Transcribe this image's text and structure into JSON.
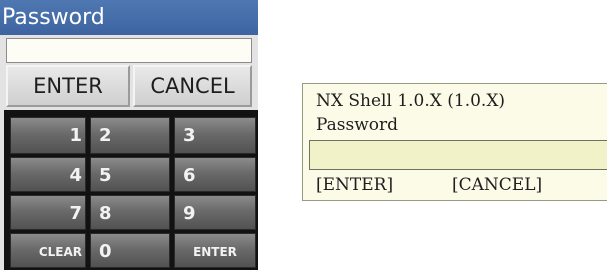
{
  "graphical_dialog": {
    "title": "Password",
    "password_value": "",
    "enter_label": "ENTER",
    "cancel_label": "CANCEL",
    "keypad": {
      "keys": [
        "1",
        "2",
        "3",
        "4",
        "5",
        "6",
        "7",
        "8",
        "9",
        "CLEAR",
        "0",
        "ENTER"
      ]
    },
    "colors": {
      "title_bar": "#4a72ad",
      "key_face": "#6a6a6a",
      "keypad_background": "#121212"
    }
  },
  "shell_dialog": {
    "title": "NX Shell  1.0.X  (1.0.X)",
    "prompt_label": "Password",
    "password_value": "",
    "enter_label": "[ENTER]",
    "cancel_label": "[CANCEL]",
    "colors": {
      "background": "#fbfbe8",
      "input": "#f2f2c9"
    }
  }
}
